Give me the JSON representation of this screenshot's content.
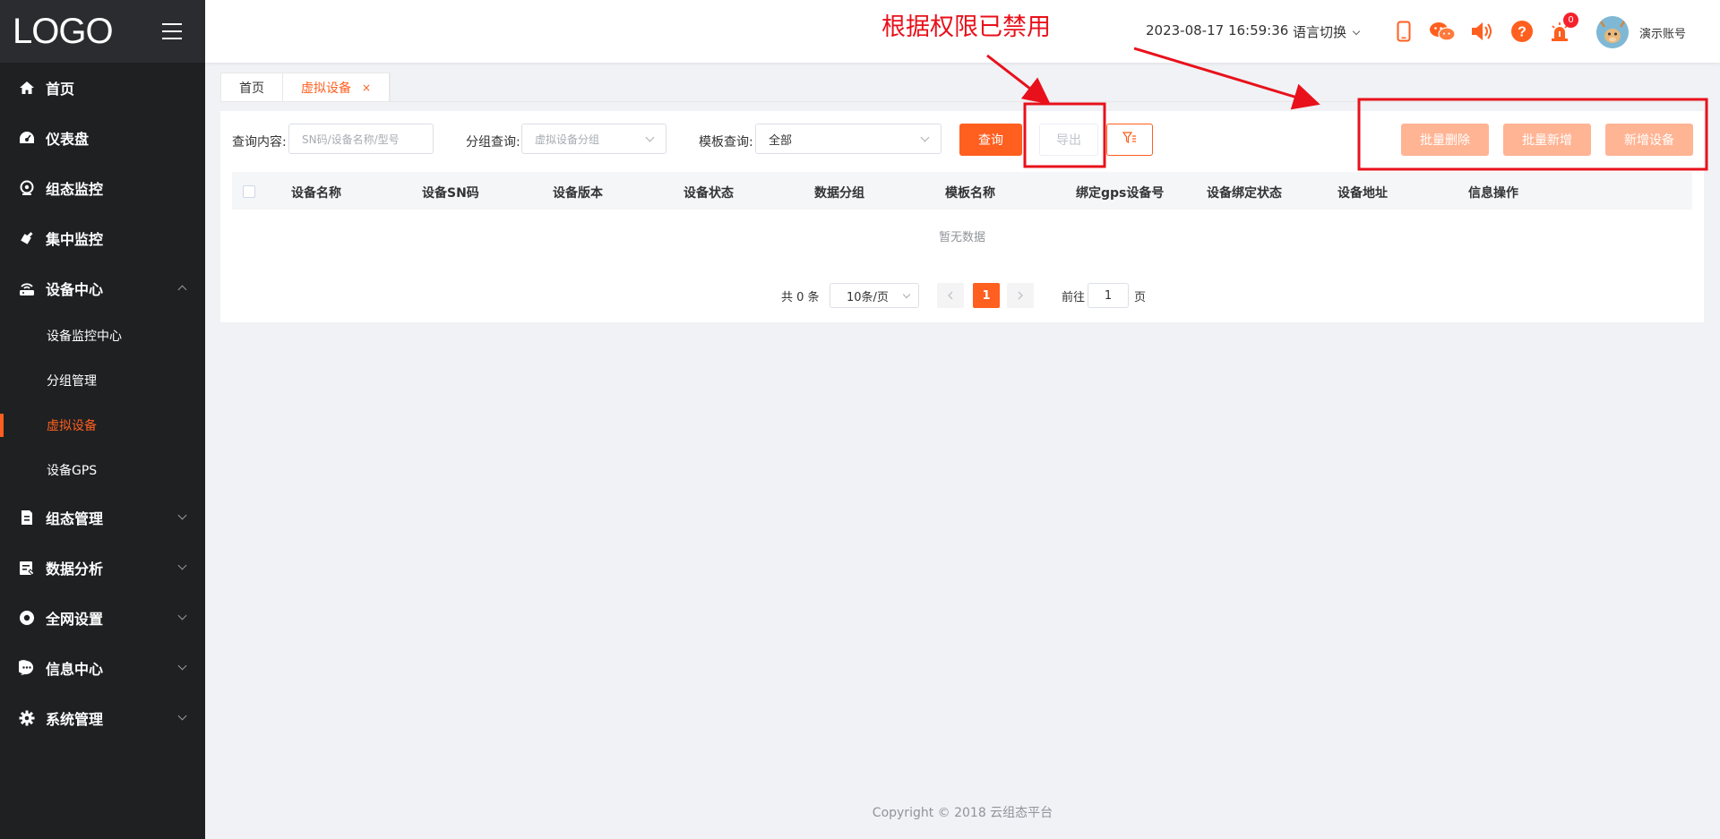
{
  "sidebar": {
    "logo": "LOGO",
    "items": [
      {
        "label": "首页",
        "icon": "home-icon"
      },
      {
        "label": "仪表盘",
        "icon": "dashboard-icon"
      },
      {
        "label": "组态监控",
        "icon": "monitor-icon"
      },
      {
        "label": "集中监控",
        "icon": "satellite-icon"
      },
      {
        "label": "设备中心",
        "icon": "router-icon",
        "expanded": true,
        "children": [
          {
            "label": "设备监控中心"
          },
          {
            "label": "分组管理"
          },
          {
            "label": "虚拟设备",
            "active": true
          },
          {
            "label": "设备GPS"
          }
        ]
      },
      {
        "label": "组态管理",
        "icon": "document-icon"
      },
      {
        "label": "数据分析",
        "icon": "chart-icon"
      },
      {
        "label": "全网设置",
        "icon": "circle-settings-icon"
      },
      {
        "label": "信息中心",
        "icon": "message-icon"
      },
      {
        "label": "系统管理",
        "icon": "gear-icon"
      }
    ]
  },
  "header": {
    "datetime": "2023-08-17 16:59:36",
    "language": "语言切换",
    "alarm_count": "0",
    "username": "演示账号",
    "icons": [
      "mobile-icon",
      "wechat-icon",
      "speaker-icon",
      "help-icon",
      "alarm-icon"
    ]
  },
  "annotation": {
    "text": "根据权限已禁用"
  },
  "tabs": [
    {
      "label": "首页"
    },
    {
      "label": "虚拟设备",
      "active": true,
      "close": "×"
    }
  ],
  "filters": {
    "query_label": "查询内容:",
    "query_placeholder": "SN码/设备名称/型号",
    "group_label": "分组查询:",
    "group_placeholder": "虚拟设备分组",
    "template_label": "模板查询:",
    "template_value": "全部"
  },
  "buttons": {
    "search": "查询",
    "export": "导出",
    "batch_delete": "批量删除",
    "batch_add": "批量新增",
    "add_device": "新增设备"
  },
  "table": {
    "columns": [
      "设备名称",
      "设备SN码",
      "设备版本",
      "设备状态",
      "数据分组",
      "模板名称",
      "绑定gps设备号",
      "设备绑定状态",
      "设备地址",
      "信息操作"
    ],
    "rows": [],
    "empty_text": "暂无数据"
  },
  "pagination": {
    "total": "共 0 条",
    "page_size": "10条/页",
    "current_page": "1",
    "goto_label": "前往",
    "goto_value": "1",
    "goto_unit": "页"
  },
  "footer": "Copyright © 2018 云组态平台",
  "colors": {
    "accent": "#ff5f1f",
    "sidebar_bg": "#1f2022",
    "annotation": "#e8111b"
  }
}
